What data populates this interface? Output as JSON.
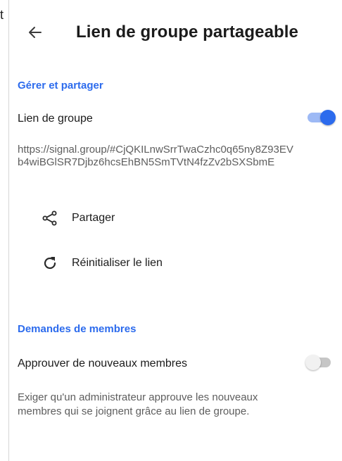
{
  "edge_fragment": "t",
  "header": {
    "title": "Lien de groupe partageable",
    "back_icon": "arrow-left-icon"
  },
  "manage_section": {
    "header": "Gérer et partager",
    "group_link_label": "Lien de groupe",
    "group_link_enabled": true,
    "link_url": "https://signal.group/#CjQKILnwSrrTwaCzhc0q65ny8Z93EVb4wiBGlSR7Djbz6hcsEhBN5SmTVtN4fzZv2bSXSbmE",
    "share_label": "Partager",
    "share_icon": "share-icon",
    "reset_label": "Réinitialiser le lien",
    "reset_icon": "refresh-icon"
  },
  "requests_section": {
    "header": "Demandes de membres",
    "approve_label": "Approuver de nouveaux membres",
    "approve_enabled": false,
    "description": "Exiger qu'un administrateur approuve les nouveaux membres qui se joignent grâce au lien de groupe."
  },
  "colors": {
    "accent": "#2c6bed",
    "text_primary": "#1b1b1b",
    "text_secondary": "#5e5e5e"
  }
}
